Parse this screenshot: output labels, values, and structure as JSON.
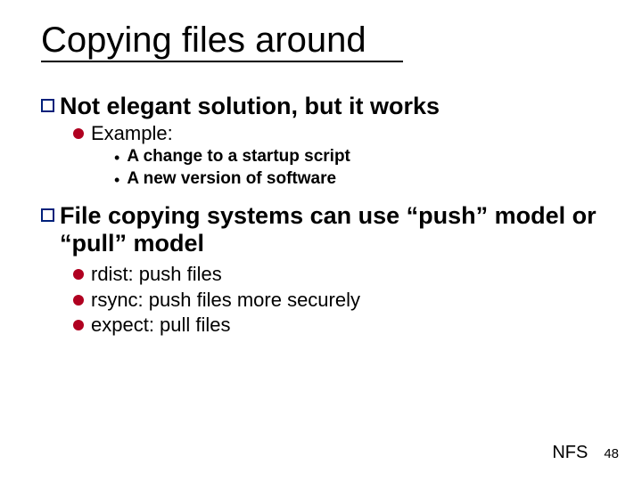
{
  "title": "Copying files around",
  "bullets": {
    "b1": {
      "text": "Not elegant solution, but it works",
      "sub": {
        "s1": {
          "text": "Example:",
          "items": {
            "i1": "A change to a startup script",
            "i2": "A new version of software"
          }
        }
      }
    },
    "b2": {
      "text": "File copying systems can use “push” model or “pull” model",
      "sub": {
        "s1": {
          "text": "rdist: push files"
        },
        "s2": {
          "text": "rsync: push files more securely"
        },
        "s3": {
          "text": "expect: pull files"
        }
      }
    }
  },
  "footer": {
    "label": "NFS",
    "page": "48"
  }
}
